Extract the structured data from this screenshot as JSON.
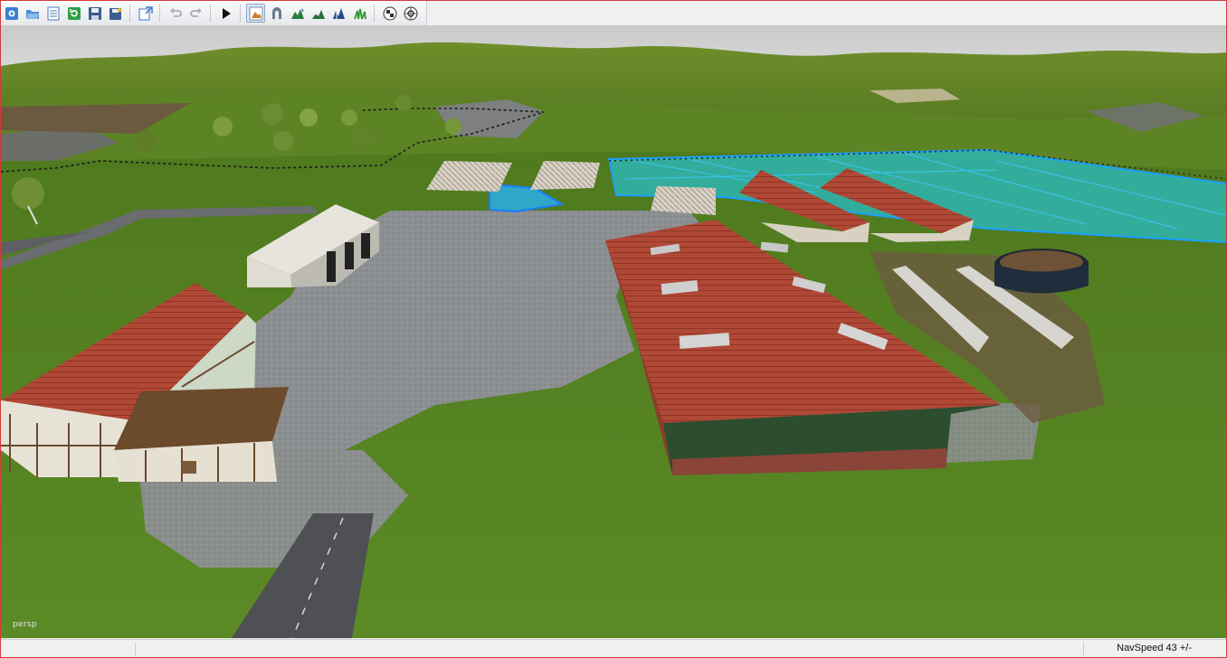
{
  "toolbar": {
    "buttons": [
      {
        "icon": "app-icon"
      },
      {
        "icon": "open-folder-icon"
      },
      {
        "icon": "list-icon"
      },
      {
        "icon": "refresh-icon"
      },
      {
        "icon": "save-icon"
      },
      {
        "icon": "save-all-icon"
      },
      {
        "separator": true
      },
      {
        "icon": "import-icon"
      },
      {
        "separator": true
      },
      {
        "icon": "undo-icon"
      },
      {
        "icon": "redo-icon"
      },
      {
        "separator": true
      },
      {
        "icon": "play-icon"
      },
      {
        "separator": true
      },
      {
        "icon": "terrain-select-icon",
        "active": true
      },
      {
        "icon": "terrain-sculpt-icon"
      },
      {
        "icon": "terrain-paint-icon"
      },
      {
        "icon": "terrain-smooth-icon"
      },
      {
        "icon": "terrain-foliage-icon"
      },
      {
        "icon": "grass-paint-icon"
      },
      {
        "separator": true
      },
      {
        "icon": "checker-icon"
      },
      {
        "icon": "navmesh-icon"
      }
    ]
  },
  "viewport": {
    "camera_label": "persp"
  },
  "statusbar": {
    "nav_speed": "NavSpeed 43 +/-"
  },
  "colors": {
    "window_border": "#d23a3a",
    "grass": "#4f7d1f",
    "asphalt": "#8e9096",
    "roof_red": "#b24a39",
    "water_overlay": "#2fb3a8",
    "selection_blue": "#2a8cff"
  }
}
